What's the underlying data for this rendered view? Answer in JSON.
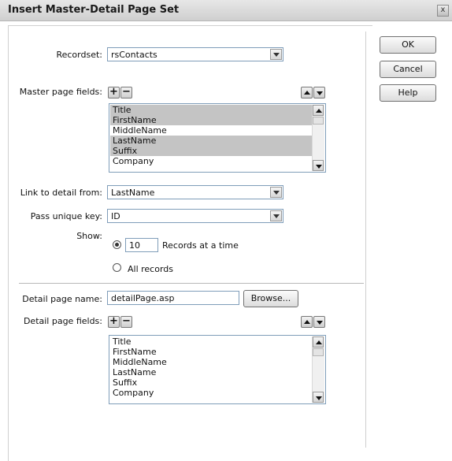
{
  "dialog": {
    "title": "Insert Master-Detail Page Set",
    "close_glyph": "x"
  },
  "recordset": {
    "label": "Recordset:",
    "value": "rsContacts"
  },
  "master_fields": {
    "label": "Master page fields:",
    "add_glyph": "+",
    "remove_glyph": "−",
    "items": [
      "Title",
      "FirstName",
      "MiddleName",
      "LastName",
      "Suffix",
      "Company"
    ],
    "selected": [
      0,
      1,
      3,
      4
    ]
  },
  "link_detail": {
    "label": "Link to detail from:",
    "value": "LastName"
  },
  "unique_key": {
    "label": "Pass unique key:",
    "value": "ID"
  },
  "show": {
    "label": "Show:",
    "records_value": "10",
    "records_text": "Records at a time",
    "all_records_text": "All records",
    "selected": "records"
  },
  "detail_name": {
    "label": "Detail page name:",
    "value": "detailPage.asp",
    "browse_label": "Browse..."
  },
  "detail_fields": {
    "label": "Detail page fields:",
    "add_glyph": "+",
    "remove_glyph": "−",
    "items": [
      "Title",
      "FirstName",
      "MiddleName",
      "LastName",
      "Suffix",
      "Company"
    ]
  },
  "buttons": {
    "ok": "OK",
    "cancel": "Cancel",
    "help": "Help"
  }
}
